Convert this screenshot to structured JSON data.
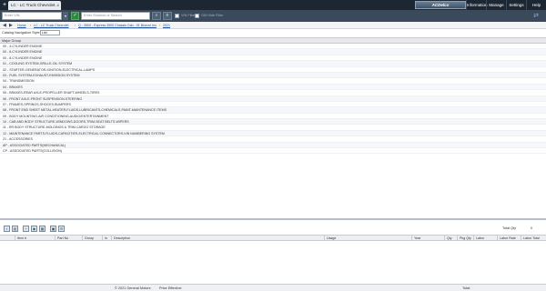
{
  "tabs": {
    "new_tab": "+",
    "active_title": "LC - LC Truck Chevrolet...",
    "close": "x"
  },
  "brand": {
    "label": "ACDelco"
  },
  "menu": [
    {
      "label": "Information"
    },
    {
      "label": "Manage"
    },
    {
      "label": "Settings"
    },
    {
      "label": "Help"
    }
  ],
  "toolbar": {
    "vin_placeholder": "Enter VIN",
    "search_placeholder": "Enter Shortcut or Search",
    "checkbox1_label": "VIN Filter",
    "checkbox2_label": "GM Hide Filter"
  },
  "breadcrumb": [
    {
      "label": "Home"
    },
    {
      "label": "LC - LC Truck Chevrolet"
    },
    {
      "label": "Q - 3500 - Express 3500 Chassis Cab - 01 Bronze Ins"
    },
    {
      "label": "2021"
    }
  ],
  "catalog_nav": {
    "label": "Catalog Navigation Style",
    "value": "List"
  },
  "major_group": {
    "header": "Major Group",
    "rows": [
      "00 - 4-CYLINDER ENGINE",
      "00 - 6-CYLINDER ENGINE",
      "00 - 8-CYLINDER ENGINE",
      "01 - COOLING SYSTEM-GRILLE-OIL SYSTEM",
      "02 - STARTER-GENERATOR-IGNITION-ELECTRICAL-LAMPS",
      "03 - FUEL SYSTEM-EXHAUST-EMISSION SYSTEM",
      "04 - TRANSMISSION",
      "04 - BRAKES",
      "05 - BRAKES-REAR AXLE-PROPELLER SHAFT-WHEELS-TIRES",
      "06 - FRONT AXLE-FRONT SUSPENSION-STEERING",
      "07 - FRAMES-SPRINGS-SHOCKS-BUMPERS",
      "08 - FRONT END SHEET METAL-HEATER-FLUIDS-LUBRICANTS-CHEMICALS-PAINT-MAINTENANCE ITEMS",
      "09 - BODY MOUNTING-AIR CONDITIONING-AUDIO/ENTERTAINMENT",
      "10 - CAB AND BODY STRUCTURE-WINDOWS-DOORS-TRIM-SEAT BELTS-WIPERS",
      "11 - RR BODY STRUCTURE-MOLDINGS & TRIM-CARGO STORAGE",
      "12 - MAINTENANCE PARTS-FLUIDS-CAPACITIES-ELECTRICAL CONNECTORS-VIN NUMBERING SYSTEM",
      "21 - ACCESSORIES",
      "AP - ASSOCIATED PARTS(MECHANICAL)",
      "CP - ASSOCIATED PARTS(COLLISION)"
    ]
  },
  "parts": {
    "total_qty_label": "Total Qty",
    "total_qty_value": "0",
    "columns": [
      "Item #",
      "Part No",
      "Group",
      "In",
      "Description",
      "Usage",
      "Year",
      "Qty",
      "Pkg Qty",
      "Labor",
      "Labor Rate",
      "Labor Total"
    ]
  },
  "footer": {
    "copyright": "© 2021 General Motors",
    "price_effective": "Price Effective:",
    "total": "Total:"
  },
  "icons": {
    "back": "arrow-left-icon",
    "forward": "arrow-right-icon",
    "search": "search-icon",
    "go": "go-icon",
    "sync": "sync-icon"
  }
}
